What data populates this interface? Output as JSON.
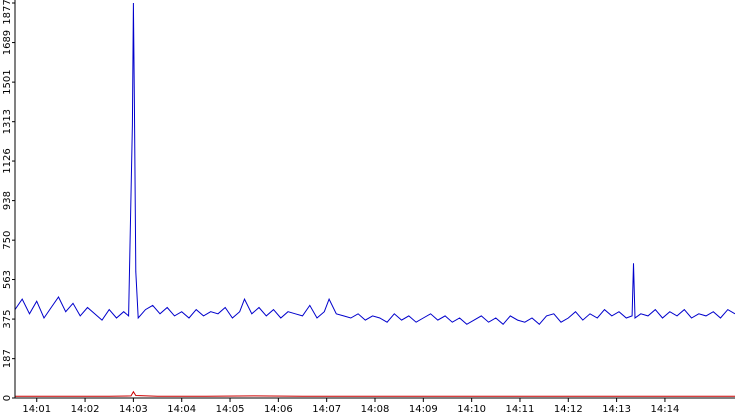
{
  "chart_data": {
    "type": "line",
    "title": "",
    "xlabel": "",
    "ylabel": "",
    "ylim": [
      0,
      1877
    ],
    "yticks": [
      "0",
      "187",
      "375",
      "563",
      "750",
      "938",
      "1126",
      "1313",
      "1501",
      "1689",
      "1877"
    ],
    "ytick_values": [
      0,
      187,
      375,
      563,
      750,
      938,
      1126,
      1313,
      1501,
      1689,
      1877
    ],
    "xticks": [
      "14:01",
      "14:02",
      "14:03",
      "14:04",
      "14:05",
      "14:06",
      "14:07",
      "14:08",
      "14:09",
      "14:10",
      "14:11",
      "14:12",
      "14:13",
      "14:14"
    ],
    "xlim_minutes": [
      0.55,
      15.45
    ],
    "grid": false,
    "legend": "none",
    "series": [
      {
        "color": "#0000cc",
        "x_minutes": [
          0.55,
          0.7,
          0.85,
          1.0,
          1.15,
          1.3,
          1.45,
          1.6,
          1.75,
          1.9,
          2.05,
          2.2,
          2.35,
          2.5,
          2.65,
          2.8,
          2.9,
          2.98,
          3.0,
          3.02,
          3.05,
          3.1,
          3.25,
          3.4,
          3.55,
          3.7,
          3.85,
          4.0,
          4.15,
          4.3,
          4.45,
          4.6,
          4.75,
          4.9,
          5.05,
          5.2,
          5.3,
          5.45,
          5.6,
          5.75,
          5.9,
          6.05,
          6.2,
          6.35,
          6.5,
          6.65,
          6.8,
          6.95,
          7.05,
          7.2,
          7.35,
          7.5,
          7.65,
          7.8,
          7.95,
          8.1,
          8.25,
          8.4,
          8.55,
          8.7,
          8.85,
          9.0,
          9.15,
          9.3,
          9.45,
          9.6,
          9.75,
          9.9,
          10.05,
          10.2,
          10.35,
          10.5,
          10.65,
          10.8,
          10.95,
          11.1,
          11.25,
          11.4,
          11.55,
          11.7,
          11.85,
          12.0,
          12.15,
          12.3,
          12.45,
          12.6,
          12.75,
          12.9,
          13.05,
          13.2,
          13.32,
          13.35,
          13.38,
          13.5,
          13.65,
          13.8,
          13.95,
          14.1,
          14.25,
          14.4,
          14.55,
          14.7,
          14.85,
          15.0,
          15.15,
          15.3,
          15.45
        ],
        "values": [
          420,
          470,
          400,
          460,
          380,
          430,
          480,
          410,
          450,
          390,
          430,
          400,
          370,
          420,
          380,
          410,
          390,
          1300,
          1877,
          1400,
          600,
          380,
          420,
          440,
          400,
          430,
          390,
          410,
          380,
          420,
          390,
          410,
          400,
          430,
          380,
          410,
          470,
          400,
          430,
          390,
          420,
          380,
          410,
          400,
          390,
          440,
          380,
          410,
          470,
          400,
          390,
          380,
          400,
          370,
          390,
          380,
          360,
          400,
          370,
          390,
          360,
          380,
          400,
          370,
          390,
          360,
          380,
          350,
          370,
          390,
          360,
          380,
          350,
          390,
          370,
          360,
          380,
          350,
          390,
          400,
          360,
          380,
          410,
          370,
          400,
          380,
          420,
          390,
          410,
          380,
          390,
          640,
          380,
          400,
          390,
          420,
          380,
          410,
          390,
          420,
          380,
          400,
          390,
          410,
          380,
          420,
          400
        ]
      },
      {
        "color": "#cc0000",
        "x_minutes": [
          0.55,
          1.5,
          2.5,
          2.95,
          3.0,
          3.05,
          3.5,
          4.5,
          5.5,
          6.5,
          7.5,
          8.5,
          9.5,
          10.5,
          11.5,
          12.5,
          13.5,
          14.5,
          15.45
        ],
        "values": [
          8,
          8,
          8,
          10,
          30,
          12,
          8,
          8,
          10,
          8,
          8,
          8,
          8,
          8,
          8,
          8,
          8,
          8,
          8
        ]
      }
    ]
  }
}
